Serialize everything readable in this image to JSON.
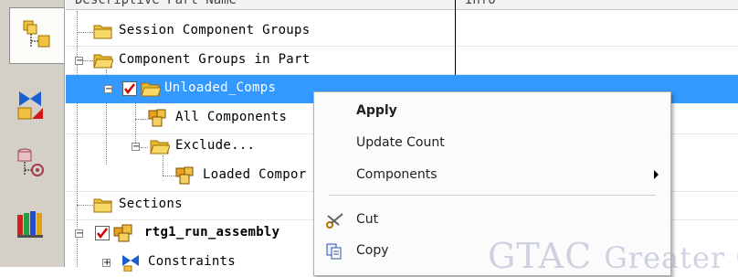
{
  "columns": {
    "name": "Descriptive Part Name",
    "info": "Info"
  },
  "tree": {
    "session_groups": "Session Component Groups",
    "groups_in_part": "Component Groups in Part",
    "unloaded_comps": "Unloaded_Comps",
    "all_components": "All Components",
    "exclude": "Exclude...",
    "loaded_comps": "Loaded Compor",
    "sections": "Sections",
    "assembly": "rtg1_run_assembly",
    "constraints": "Constraints"
  },
  "menu": {
    "apply": "Apply",
    "update_count": "Update Count",
    "components": "Components",
    "cut": "Cut",
    "copy": "Copy"
  },
  "watermark": {
    "main": "GTAC",
    "tail": "Greater C"
  },
  "colors": {
    "selection": "#3399ff",
    "check_red": "#d00000",
    "folder": "#f0c040",
    "part_orange": "#e8a020"
  }
}
